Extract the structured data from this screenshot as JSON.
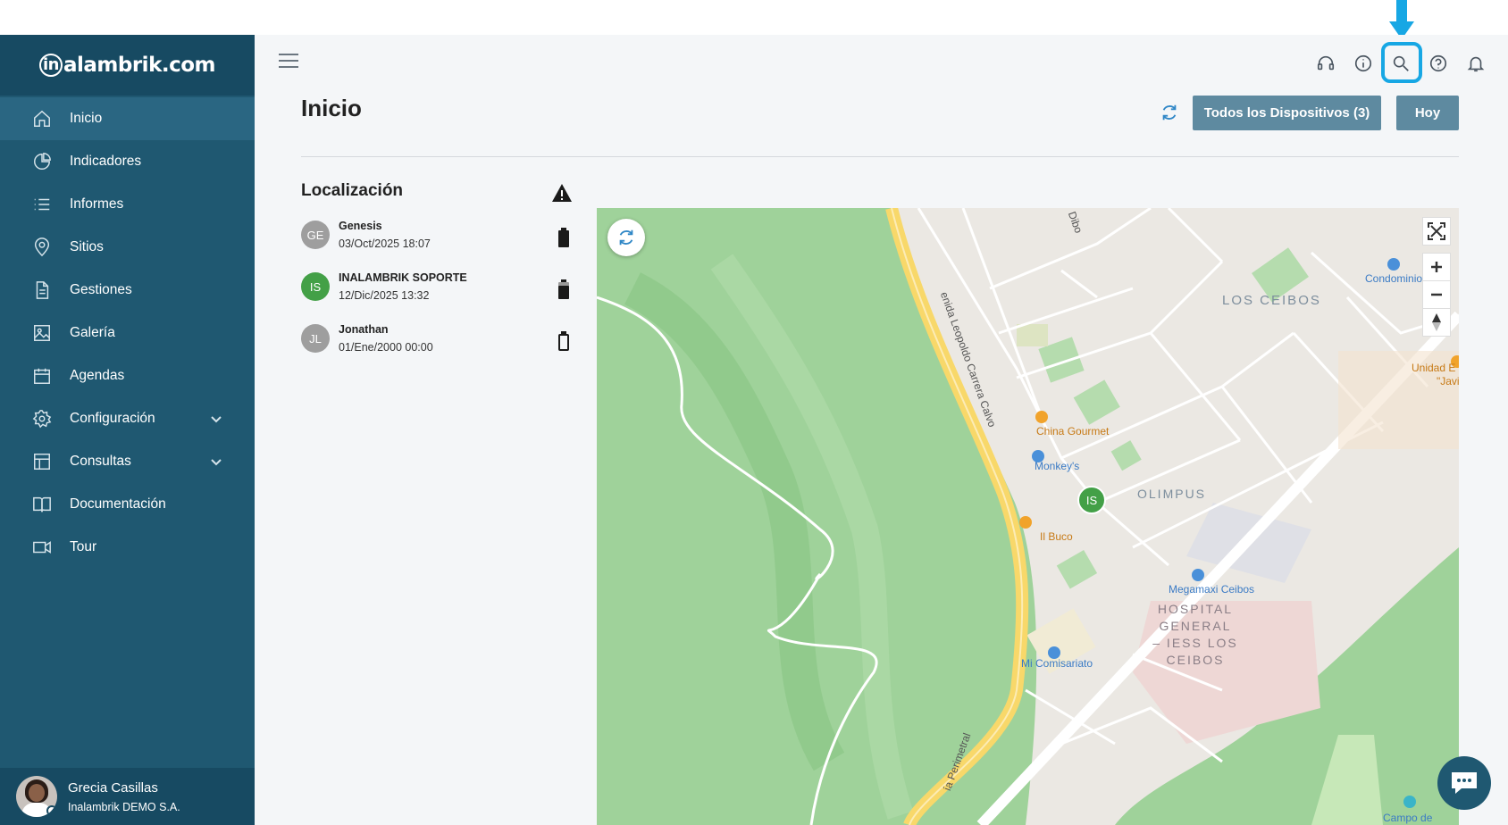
{
  "brand": {
    "logo_prefix": "in",
    "logo_rest": "alambrik.com"
  },
  "sidebar": {
    "items": [
      {
        "label": "Inicio",
        "icon": "home-icon"
      },
      {
        "label": "Indicadores",
        "icon": "pie-chart-icon"
      },
      {
        "label": "Informes",
        "icon": "list-icon"
      },
      {
        "label": "Sitios",
        "icon": "map-pin-icon"
      },
      {
        "label": "Gestiones",
        "icon": "document-icon"
      },
      {
        "label": "Galería",
        "icon": "image-icon"
      },
      {
        "label": "Agendas",
        "icon": "calendar-icon"
      },
      {
        "label": "Configuración",
        "icon": "gear-icon"
      },
      {
        "label": "Consultas",
        "icon": "table-icon"
      },
      {
        "label": "Documentación",
        "icon": "book-icon"
      },
      {
        "label": "Tour",
        "icon": "video-icon"
      }
    ],
    "active": "Inicio"
  },
  "profile": {
    "name": "Grecia Casillas",
    "org": "Inalambrik DEMO S.A."
  },
  "header": {
    "icons": [
      "headset-icon",
      "info-icon",
      "search-icon",
      "help-icon",
      "bell-icon"
    ],
    "highlighted": "search-icon"
  },
  "page": {
    "title": "Inicio",
    "devices_button": "Todos los Dispositivos (3)",
    "today_button": "Hoy"
  },
  "location": {
    "title": "Localización",
    "devices": [
      {
        "initials": "GE",
        "name": "Genesis",
        "time": "03/Oct/2025 18:07",
        "color": "#9e9e9e",
        "battery": "full"
      },
      {
        "initials": "IS",
        "name": "INALAMBRIK SOPORTE",
        "time": "12/Dic/2025 13:32",
        "color": "#43a047",
        "battery": "high"
      },
      {
        "initials": "JL",
        "name": "Jonathan",
        "time": "01/Ene/2000 00:00",
        "color": "#9e9e9e",
        "battery": "empty"
      }
    ]
  },
  "map": {
    "marker": "IS",
    "labels": {
      "los_ceibos": "LOS CEIBOS",
      "olimpus": "OLIMPUS",
      "hospital": "HOSPITAL GENERAL – IESS LOS CEIBOS",
      "hospital_l1": "HOSPITAL",
      "hospital_l2": "GENERAL",
      "hospital_l3": "– IESS LOS",
      "hospital_l4": "CEIBOS",
      "china_gourmet": "China Gourmet",
      "monkey": "Monkey's",
      "il_buco": "Il Buco",
      "megamaxi": "Megamaxi Ceibos",
      "mi_comisariato": "Mi Comisariato",
      "condominio": "Condominio",
      "unidad": "Unidad E",
      "javi": "\"Javi",
      "campo": "Campo de",
      "avenida": "enida Leopoldo Carrera Calvo",
      "perimetral": "ía Perimetral",
      "dibo": "Dibo"
    }
  }
}
